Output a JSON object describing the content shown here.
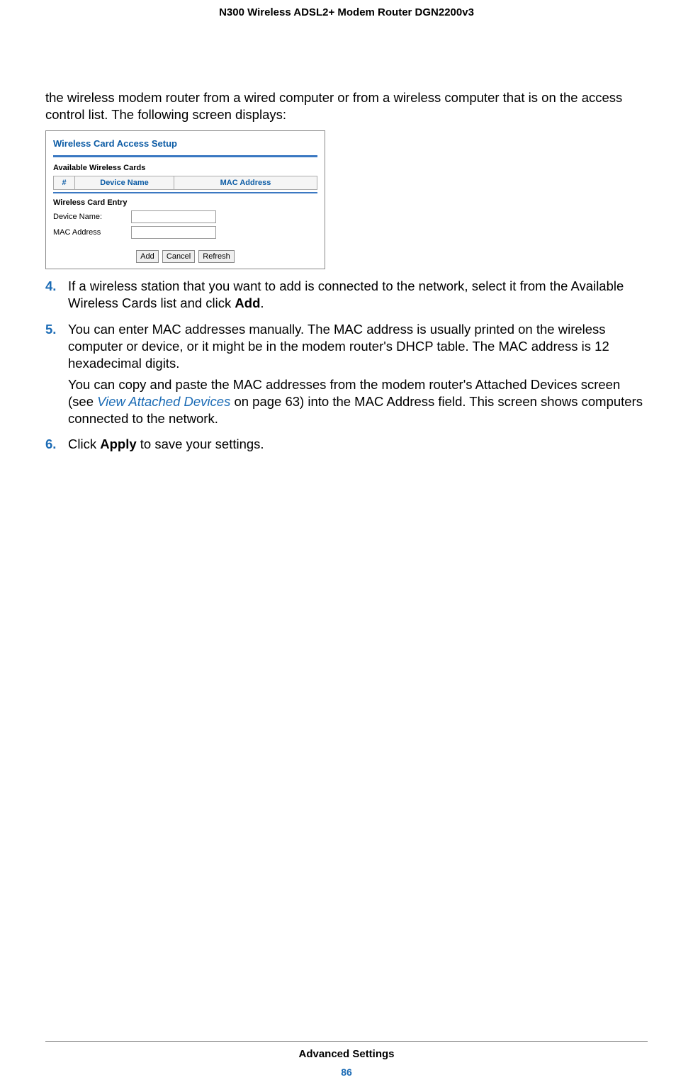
{
  "header": {
    "title": "N300 Wireless ADSL2+ Modem Router DGN2200v3"
  },
  "intro": "the wireless modem router from a wired computer or from a wireless computer that is on the access control list. The following screen displays:",
  "screenshot": {
    "title": "Wireless Card Access Setup",
    "available_heading": "Available Wireless Cards",
    "columns": {
      "num": "#",
      "device_name": "Device Name",
      "mac": "MAC Address"
    },
    "entry_heading": "Wireless Card Entry",
    "device_label": "Device Name:",
    "mac_label": "MAC Address",
    "buttons": {
      "add": "Add",
      "cancel": "Cancel",
      "refresh": "Refresh"
    }
  },
  "steps": {
    "s4": {
      "num": "4.",
      "text_a": "If a wireless station that you want to add is connected to the network, select it from the Available Wireless Cards list and click ",
      "bold_a": "Add",
      "text_b": "."
    },
    "s5": {
      "num": "5.",
      "p1": "You can enter MAC addresses manually. The MAC address is usually printed on the wireless computer or device, or it might be in the modem router's DHCP table. The MAC address is 12 hexadecimal digits.",
      "p2_a": "You can copy and paste the MAC addresses from the modem router's Attached Devices screen (see ",
      "p2_link": "View Attached Devices",
      "p2_b": " on page 63) into the MAC Address field. This screen shows computers connected to the network."
    },
    "s6": {
      "num": "6.",
      "text_a": "Click ",
      "bold_a": "Apply",
      "text_b": " to save your settings."
    }
  },
  "footer": {
    "section": "Advanced Settings",
    "page": "86"
  }
}
